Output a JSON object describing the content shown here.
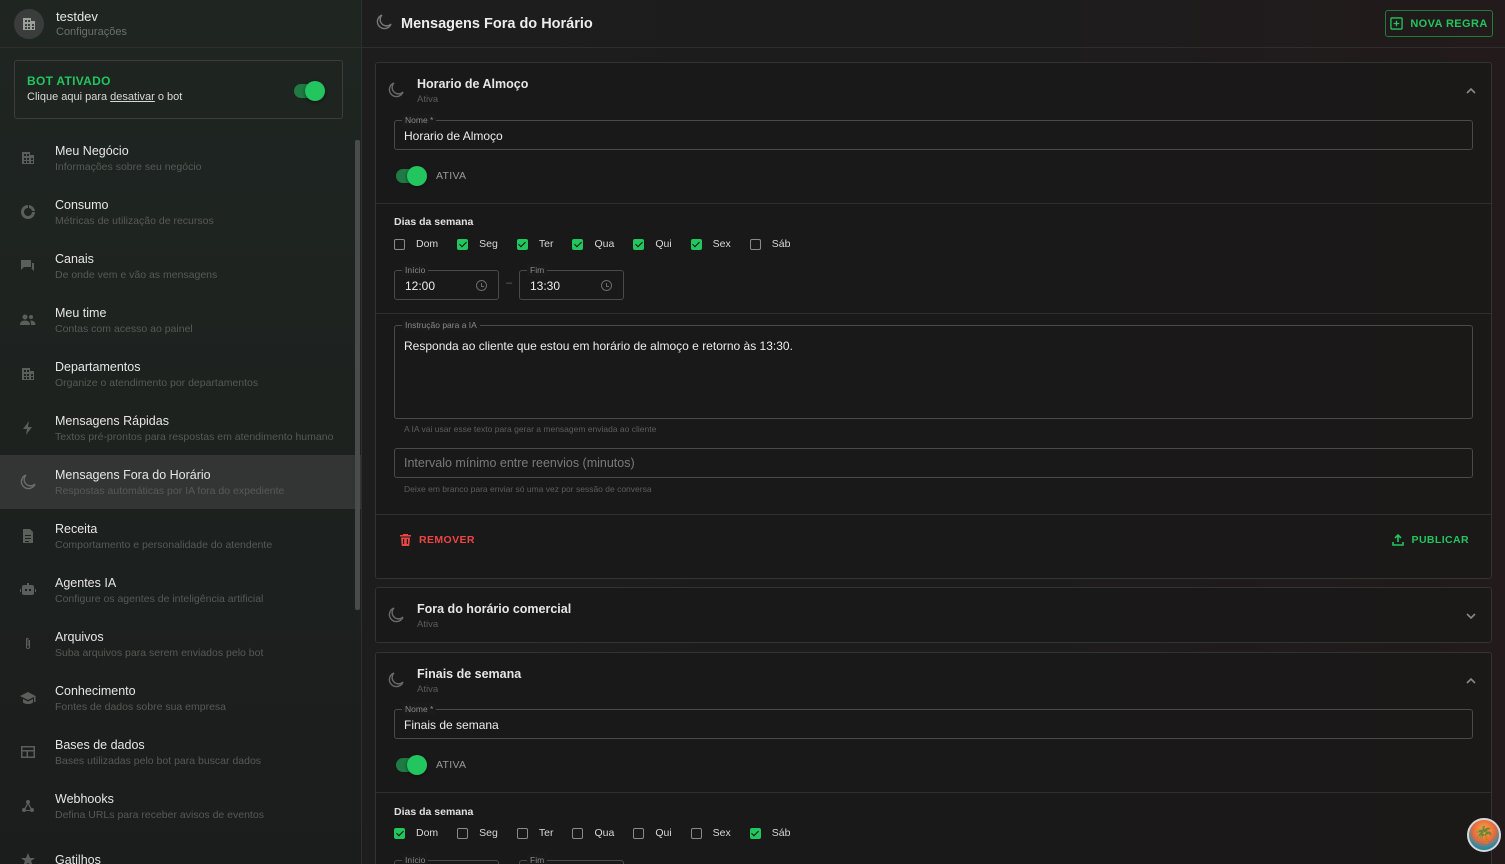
{
  "org": {
    "name": "testdev",
    "subtitle": "Configurações"
  },
  "bot_card": {
    "title": "BOT ATIVADO",
    "prefix": "Clique aqui para ",
    "link": "desativar",
    "suffix": " o bot",
    "enabled": true
  },
  "sidebar": {
    "items": [
      {
        "label": "Meu Negócio",
        "sub": "Informações sobre seu negócio",
        "icon": "building-icon"
      },
      {
        "label": "Consumo",
        "sub": "Métricas de utilização de recursos",
        "icon": "donut-chart-icon"
      },
      {
        "label": "Canais",
        "sub": "De onde vem e vão as mensagens",
        "icon": "chat-icon"
      },
      {
        "label": "Meu time",
        "sub": "Contas com acesso ao painel",
        "icon": "people-icon"
      },
      {
        "label": "Departamentos",
        "sub": "Organize o atendimento por departamentos",
        "icon": "building-icon"
      },
      {
        "label": "Mensagens Rápidas",
        "sub": "Textos pré-prontos para respostas em atendimento humano",
        "icon": "bolt-icon"
      },
      {
        "label": "Mensagens Fora do Horário",
        "sub": "Respostas automáticas por IA fora do expediente",
        "icon": "moon-icon",
        "active": true
      },
      {
        "label": "Receita",
        "sub": "Comportamento e personalidade do atendente",
        "icon": "document-icon"
      },
      {
        "label": "Agentes IA",
        "sub": "Configure os agentes de inteligência artificial",
        "icon": "robot-icon"
      },
      {
        "label": "Arquivos",
        "sub": "Suba arquivos para serem enviados pelo bot",
        "icon": "paperclip-icon"
      },
      {
        "label": "Conhecimento",
        "sub": "Fontes de dados sobre sua empresa",
        "icon": "graduation-cap-icon"
      },
      {
        "label": "Bases de dados",
        "sub": "Bases utilizadas pelo bot para buscar dados",
        "icon": "table-icon"
      },
      {
        "label": "Webhooks",
        "sub": "Defina URLs para receber avisos de eventos",
        "icon": "webhook-icon"
      },
      {
        "label": "Gatilhos",
        "sub": "",
        "icon": "trigger-icon"
      }
    ]
  },
  "header": {
    "title": "Mensagens Fora do Horário",
    "new_rule_label": "NOVA REGRA"
  },
  "rules": [
    {
      "title": "Horario de Almoço",
      "status": "Ativa",
      "expanded": true,
      "name_label": "Nome *",
      "name_value": "Horario de Almoço",
      "active_label": "ATIVA",
      "days_title": "Dias da semana",
      "days": [
        {
          "label": "Dom",
          "checked": false
        },
        {
          "label": "Seg",
          "checked": true
        },
        {
          "label": "Ter",
          "checked": true
        },
        {
          "label": "Qua",
          "checked": true
        },
        {
          "label": "Qui",
          "checked": true
        },
        {
          "label": "Sex",
          "checked": true
        },
        {
          "label": "Sáb",
          "checked": false
        }
      ],
      "start_label": "Início",
      "start_value": "12:00",
      "end_label": "Fim",
      "end_value": "13:30",
      "instruction_label": "Instrução para a IA",
      "instruction_value": "Responda ao cliente que estou em horário de almoço e retorno às 13:30.",
      "instruction_helper": "A IA vai usar esse texto para gerar a mensagem enviada ao cliente",
      "interval_placeholder": "Intervalo mínimo entre reenvios (minutos)",
      "interval_helper": "Deixe em branco para enviar só uma vez por sessão de conversa",
      "remove_label": "REMOVER",
      "publish_label": "PUBLICAR"
    },
    {
      "title": "Fora do horário comercial",
      "status": "Ativa",
      "expanded": false
    },
    {
      "title": "Finais de semana",
      "status": "Ativa",
      "expanded": true,
      "name_label": "Nome *",
      "name_value": "Finais de semana",
      "active_label": "ATIVA",
      "days_title": "Dias da semana",
      "days": [
        {
          "label": "Dom",
          "checked": true
        },
        {
          "label": "Seg",
          "checked": false
        },
        {
          "label": "Ter",
          "checked": false
        },
        {
          "label": "Qua",
          "checked": false
        },
        {
          "label": "Qui",
          "checked": false
        },
        {
          "label": "Sex",
          "checked": false
        },
        {
          "label": "Sáb",
          "checked": true
        }
      ],
      "start_label": "Início",
      "end_label": "Fim"
    }
  ],
  "colors": {
    "accent": "#22c55e",
    "danger": "#ef4444"
  }
}
